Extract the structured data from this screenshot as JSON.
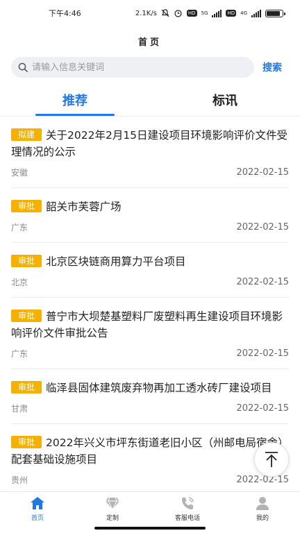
{
  "status_bar": {
    "time": "下午4:46",
    "network_speed": "2.1K/s",
    "sim1_label": "HD",
    "sim1_tech": "5G",
    "sim2_label": "HD",
    "sim2_tech": "4G",
    "icons": [
      "mute-icon",
      "alarm-icon",
      "signal-icon",
      "battery-icon"
    ],
    "battery_level": 0.88
  },
  "header": {
    "title": "首页"
  },
  "search": {
    "placeholder": "请输入信息关键词",
    "value": "",
    "button_label": "搜索"
  },
  "tabs": [
    {
      "label": "推荐",
      "active": true
    },
    {
      "label": "标讯",
      "active": false
    }
  ],
  "items": [
    {
      "badge": "拟建",
      "title": "关于2022年2月15日建设项目环境影响评价文件受理情况的公示",
      "region": "安徽",
      "date": "2022-02-15"
    },
    {
      "badge": "审批",
      "title": "韶关市芙蓉广场",
      "region": "广东",
      "date": "2022-02-15"
    },
    {
      "badge": "审批",
      "title": "北京区块链商用算力平台项目",
      "region": "北京",
      "date": "2022-02-15"
    },
    {
      "badge": "审批",
      "title": "普宁市大坝楚基塑料厂废塑料再生建设项目环境影响评价文件审批公告",
      "region": "广东",
      "date": "2022-02-15"
    },
    {
      "badge": "审批",
      "title": "临泽县固体建筑废弃物再加工透水砖厂建设项目",
      "region": "甘肃",
      "date": "2022-02-15"
    },
    {
      "badge": "审批",
      "title": "2022年兴义市坪东街道老旧小区（州邮电局宿舍）配套基础设施项目",
      "region": "贵州",
      "date": "2022-02-15"
    }
  ],
  "bottom_nav": [
    {
      "label": "首页",
      "icon": "home-icon",
      "active": true
    },
    {
      "label": "定制",
      "icon": "diamond-icon",
      "active": false
    },
    {
      "label": "客服电话",
      "icon": "phone-icon",
      "active": false
    },
    {
      "label": "我的",
      "icon": "user-icon",
      "active": false
    }
  ],
  "colors": {
    "accent": "#1f78e6",
    "badge": "#f6b100"
  }
}
